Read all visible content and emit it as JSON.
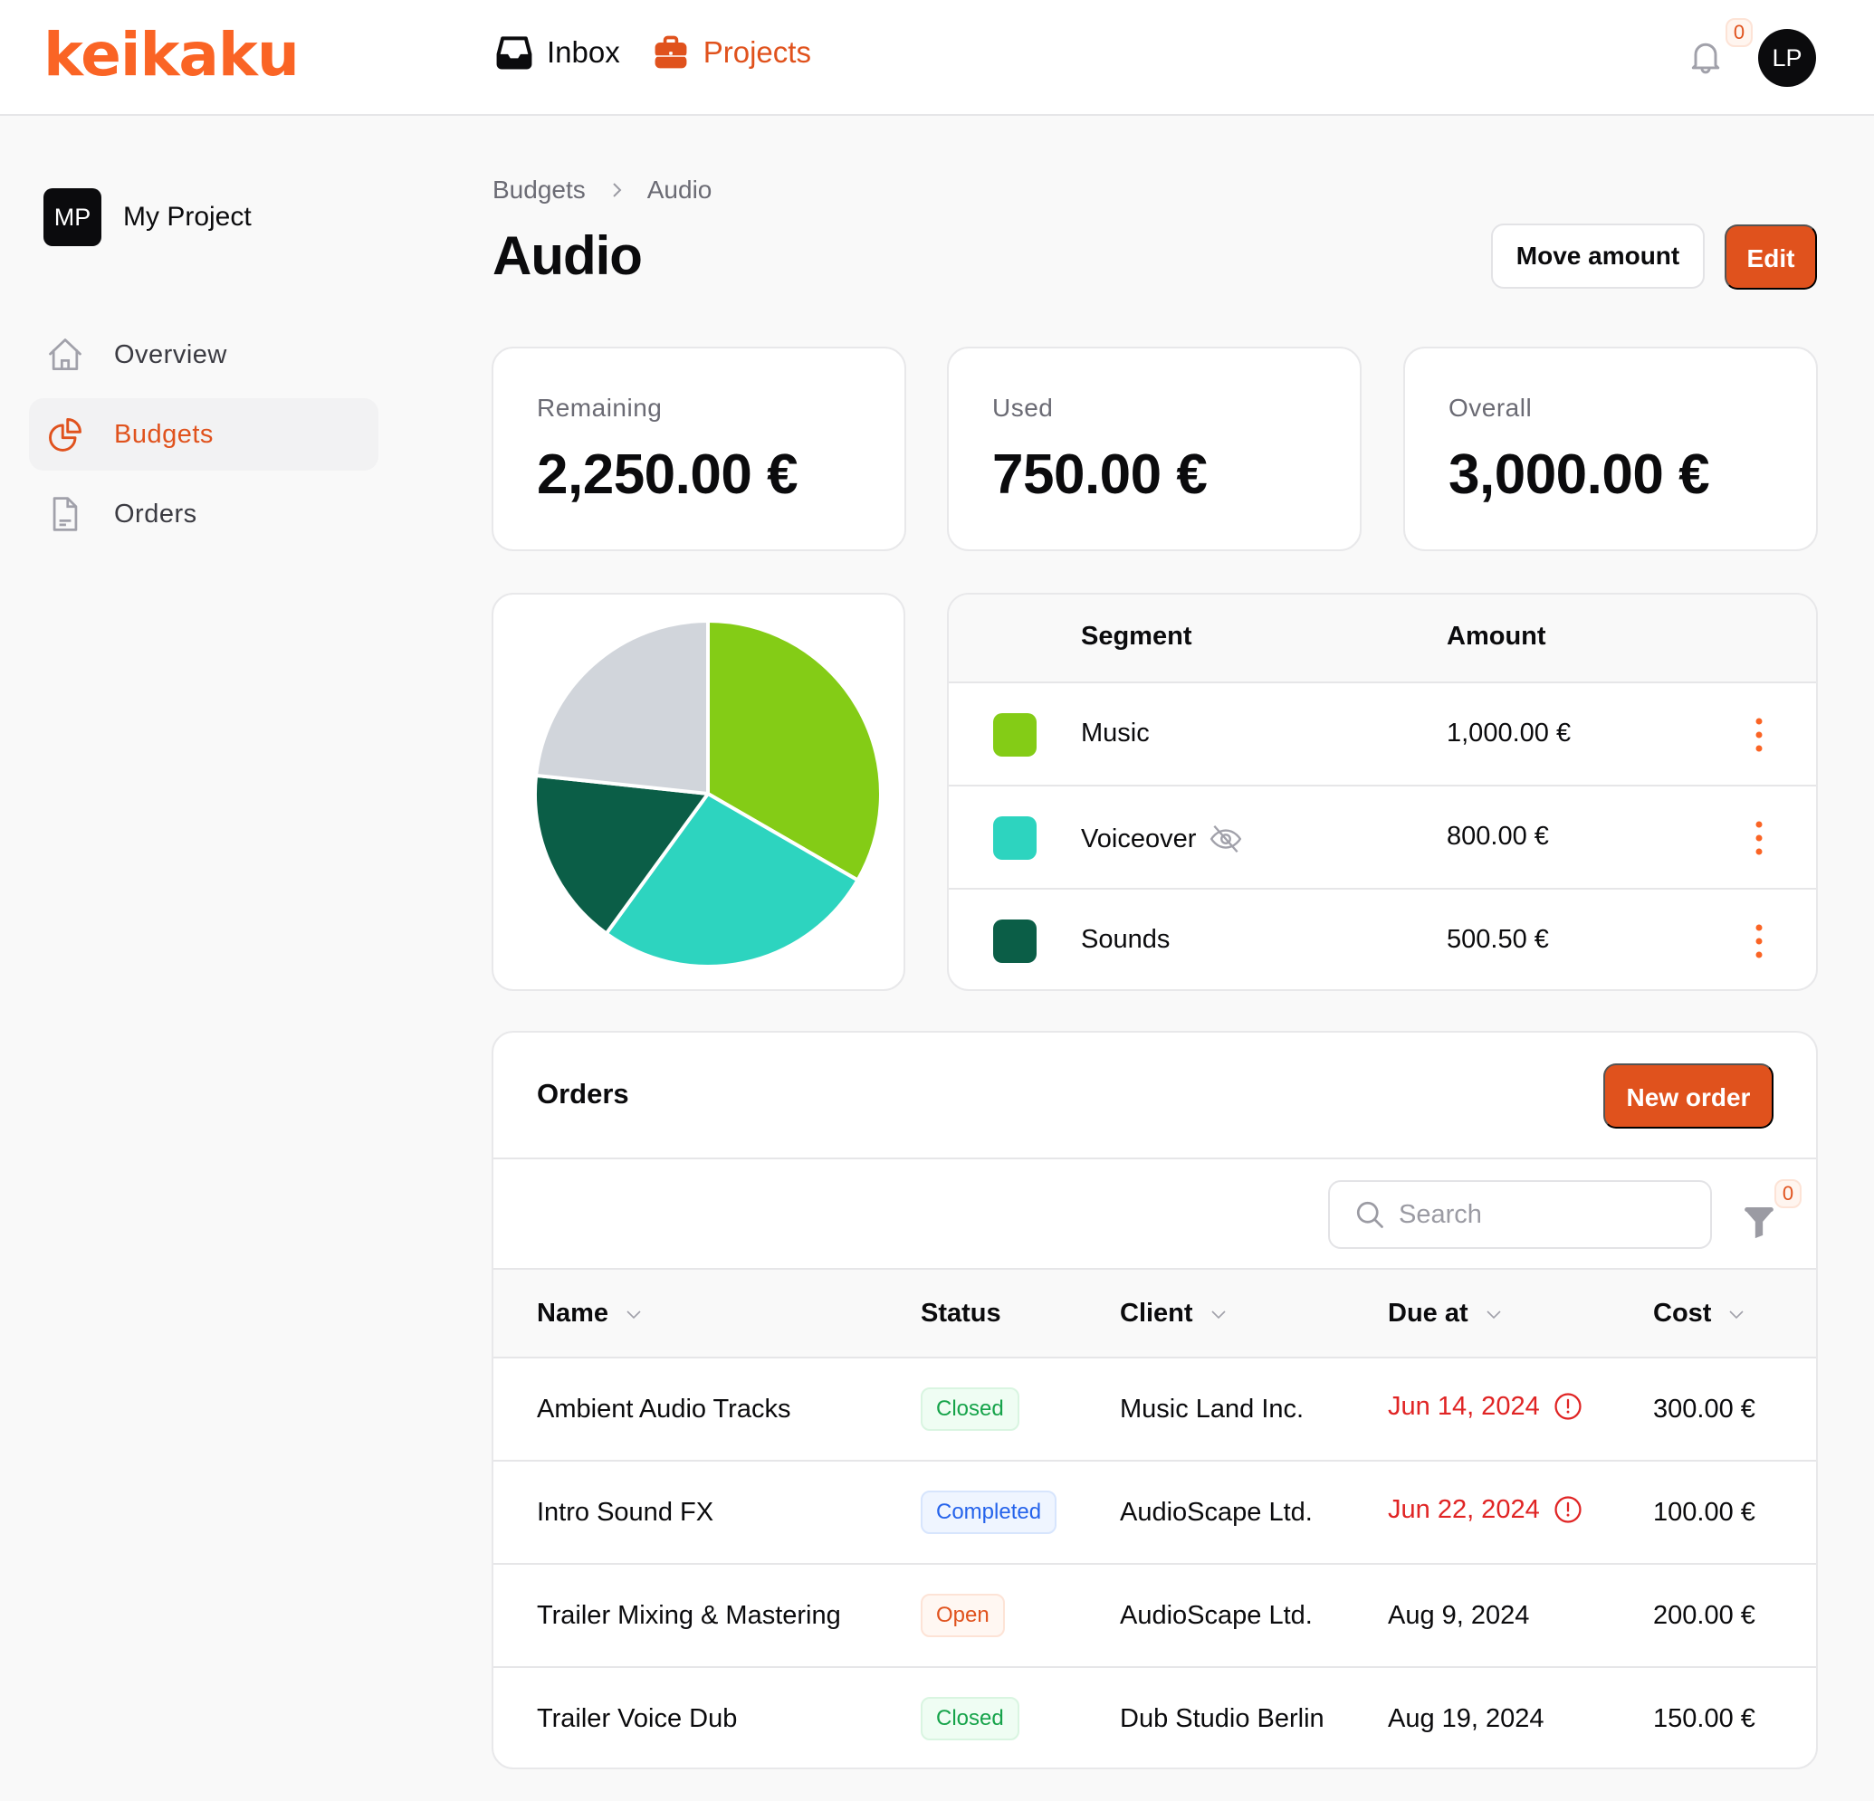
{
  "app": {
    "logo": "keikaku",
    "nav": [
      {
        "label": "Inbox",
        "icon": "inbox-icon",
        "active": false
      },
      {
        "label": "Projects",
        "icon": "briefcase-icon",
        "active": true
      }
    ],
    "notifications_count": "0",
    "user_initials": "LP",
    "accent_color": "#e0521d"
  },
  "sidebar": {
    "project_initials": "MP",
    "project_name": "My Project",
    "items": [
      {
        "label": "Overview",
        "icon": "home-icon",
        "active": false
      },
      {
        "label": "Budgets",
        "icon": "pie-chart-icon",
        "active": true
      },
      {
        "label": "Orders",
        "icon": "document-icon",
        "active": false
      }
    ]
  },
  "page": {
    "breadcrumb": [
      "Budgets",
      "Audio"
    ],
    "title": "Audio",
    "move_amount_label": "Move amount",
    "edit_label": "Edit"
  },
  "stats": [
    {
      "label": "Remaining",
      "value": "2,250.00 €"
    },
    {
      "label": "Used",
      "value": "750.00 €"
    },
    {
      "label": "Overall",
      "value": "3,000.00 €"
    }
  ],
  "segments": {
    "headers": {
      "segment": "Segment",
      "amount": "Amount"
    },
    "rows": [
      {
        "name": "Music",
        "amount": "1,000.00 €",
        "color": "#84cc16",
        "hidden": false
      },
      {
        "name": "Voiceover",
        "amount": "800.00 €",
        "color": "#2dd4bf",
        "hidden": true
      },
      {
        "name": "Sounds",
        "amount": "500.50 €",
        "color": "#0b5e47",
        "hidden": false
      }
    ]
  },
  "chart_data": {
    "type": "pie",
    "title": "",
    "start_angle": "top, clockwise",
    "slices": [
      {
        "label": "Music",
        "value": 1000.0,
        "color": "#84cc16"
      },
      {
        "label": "Voiceover",
        "value": 800.0,
        "color": "#2dd4bf"
      },
      {
        "label": "Sounds",
        "value": 500.5,
        "color": "#0b5e47"
      },
      {
        "label": "Unallocated",
        "value": 699.5,
        "color": "#d1d5db"
      }
    ],
    "total": 3000.0
  },
  "orders": {
    "title": "Orders",
    "new_order_label": "New order",
    "search_placeholder": "Search",
    "search_value": "",
    "filter_count": "0",
    "columns": [
      {
        "label": "Name",
        "sortable": true
      },
      {
        "label": "Status",
        "sortable": false
      },
      {
        "label": "Client",
        "sortable": true
      },
      {
        "label": "Due at",
        "sortable": true
      },
      {
        "label": "Cost",
        "sortable": true
      }
    ],
    "rows": [
      {
        "name": "Ambient Audio Tracks",
        "status": "Closed",
        "client": "Music Land Inc.",
        "due": "Jun 14, 2024",
        "overdue": true,
        "cost": "300.00 €"
      },
      {
        "name": "Intro Sound FX",
        "status": "Completed",
        "client": "AudioScape Ltd.",
        "due": "Jun 22, 2024",
        "overdue": true,
        "cost": "100.00 €"
      },
      {
        "name": "Trailer Mixing & Mastering",
        "status": "Open",
        "client": "AudioScape Ltd.",
        "due": "Aug 9, 2024",
        "overdue": false,
        "cost": "200.00 €"
      },
      {
        "name": "Trailer Voice Dub",
        "status": "Closed",
        "client": "Dub Studio Berlin",
        "due": "Aug 19, 2024",
        "overdue": false,
        "cost": "150.00 €"
      }
    ],
    "status_styles": {
      "Closed": {
        "color": "#16a34a",
        "bg": "#effdf3",
        "border": "#d9f5e1"
      },
      "Completed": {
        "color": "#2563eb",
        "bg": "#eff5ff",
        "border": "#d7e5fd"
      },
      "Open": {
        "color": "#e0521d",
        "bg": "#fff7f2",
        "border": "#fde3d6"
      }
    }
  }
}
